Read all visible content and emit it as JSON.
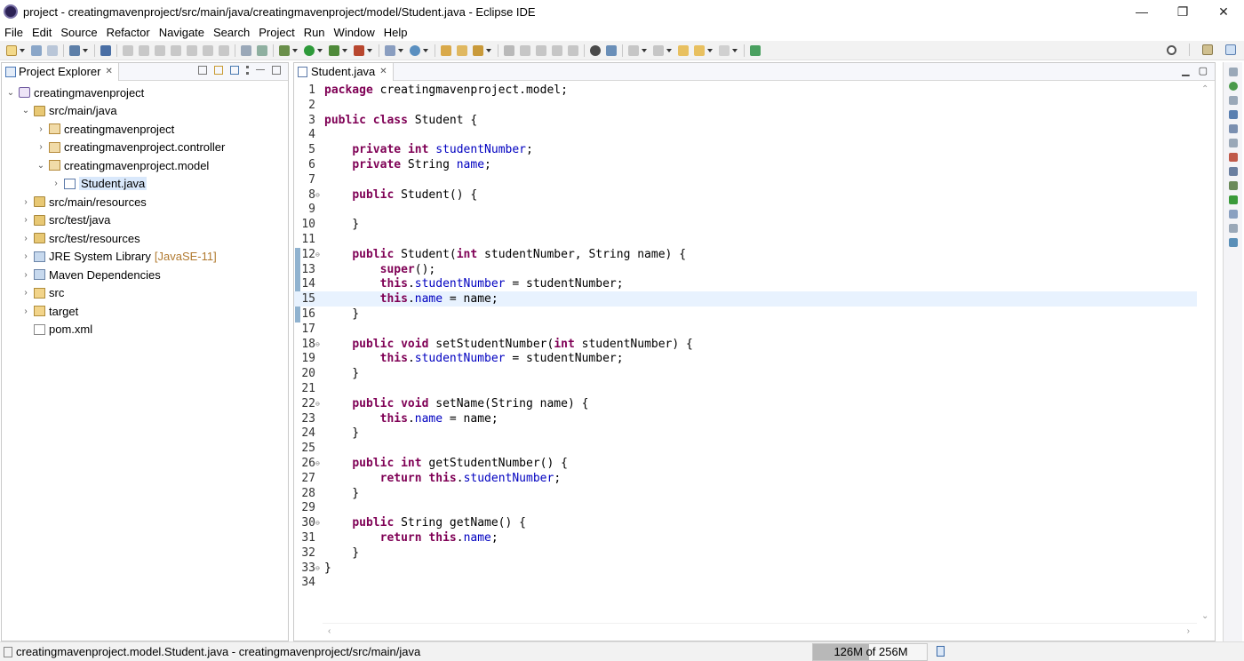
{
  "window": {
    "title": "project - creatingmavenproject/src/main/java/creatingmavenproject/model/Student.java - Eclipse IDE",
    "minimize": "—",
    "restore": "❐",
    "close": "✕"
  },
  "menu": [
    "File",
    "Edit",
    "Source",
    "Refactor",
    "Navigate",
    "Search",
    "Project",
    "Run",
    "Window",
    "Help"
  ],
  "explorer": {
    "tab_label": "Project Explorer",
    "tab_close": "✕",
    "items": [
      {
        "label": "creatingmavenproject",
        "indent": 0,
        "twisty": "⌄",
        "icon": "project-icon"
      },
      {
        "label": "src/main/java",
        "indent": 1,
        "twisty": "⌄",
        "icon": "source-folder-icon"
      },
      {
        "label": "creatingmavenproject",
        "indent": 2,
        "twisty": "›",
        "icon": "package-icon"
      },
      {
        "label": "creatingmavenproject.controller",
        "indent": 2,
        "twisty": "›",
        "icon": "package-icon"
      },
      {
        "label": "creatingmavenproject.model",
        "indent": 2,
        "twisty": "⌄",
        "icon": "package-icon"
      },
      {
        "label": "Student.java",
        "indent": 3,
        "twisty": "›",
        "icon": "java-file-icon",
        "selected": true
      },
      {
        "label": "src/main/resources",
        "indent": 1,
        "twisty": "›",
        "icon": "source-folder-icon"
      },
      {
        "label": "src/test/java",
        "indent": 1,
        "twisty": "›",
        "icon": "source-folder-icon"
      },
      {
        "label": "src/test/resources",
        "indent": 1,
        "twisty": "›",
        "icon": "source-folder-icon"
      },
      {
        "label": "JRE System Library",
        "suffix": "[JavaSE-11]",
        "indent": 1,
        "twisty": "›",
        "icon": "library-icon"
      },
      {
        "label": "Maven Dependencies",
        "indent": 1,
        "twisty": "›",
        "icon": "library-icon"
      },
      {
        "label": "src",
        "indent": 1,
        "twisty": "›",
        "icon": "folder-icon"
      },
      {
        "label": "target",
        "indent": 1,
        "twisty": "›",
        "icon": "folder-icon"
      },
      {
        "label": "pom.xml",
        "indent": 1,
        "twisty": "",
        "icon": "xml-file-icon"
      }
    ]
  },
  "editor": {
    "tab_label": "Student.java",
    "tab_close": "✕",
    "current_line": 15,
    "lines": [
      {
        "n": "1",
        "fold": "",
        "tokens": [
          [
            "kw",
            "package"
          ],
          [
            "t",
            " creatingmavenproject.model;"
          ]
        ]
      },
      {
        "n": "2",
        "fold": "",
        "tokens": []
      },
      {
        "n": "3",
        "fold": "",
        "tokens": [
          [
            "kw",
            "public"
          ],
          [
            "t",
            " "
          ],
          [
            "kw",
            "class"
          ],
          [
            "t",
            " Student {"
          ]
        ]
      },
      {
        "n": "4",
        "fold": "",
        "tokens": []
      },
      {
        "n": "5",
        "fold": "",
        "tokens": [
          [
            "t",
            "    "
          ],
          [
            "kw",
            "private"
          ],
          [
            "t",
            " "
          ],
          [
            "kw",
            "int"
          ],
          [
            "t",
            " "
          ],
          [
            "fld",
            "studentNumber"
          ],
          [
            "t",
            ";"
          ]
        ]
      },
      {
        "n": "6",
        "fold": "",
        "tokens": [
          [
            "t",
            "    "
          ],
          [
            "kw",
            "private"
          ],
          [
            "t",
            " String "
          ],
          [
            "fld",
            "name"
          ],
          [
            "t",
            ";"
          ]
        ]
      },
      {
        "n": "7",
        "fold": "",
        "tokens": []
      },
      {
        "n": "8",
        "fold": "⊖",
        "tokens": [
          [
            "t",
            "    "
          ],
          [
            "kw",
            "public"
          ],
          [
            "t",
            " Student() {"
          ]
        ]
      },
      {
        "n": "9",
        "fold": "",
        "tokens": []
      },
      {
        "n": "10",
        "fold": "",
        "tokens": [
          [
            "t",
            "    }"
          ]
        ]
      },
      {
        "n": "11",
        "fold": "",
        "tokens": []
      },
      {
        "n": "12",
        "fold": "⊖",
        "tokens": [
          [
            "t",
            "    "
          ],
          [
            "kw",
            "public"
          ],
          [
            "t",
            " Student("
          ],
          [
            "kw",
            "int"
          ],
          [
            "t",
            " studentNumber, String name) {"
          ]
        ]
      },
      {
        "n": "13",
        "fold": "",
        "tokens": [
          [
            "t",
            "        "
          ],
          [
            "kw",
            "super"
          ],
          [
            "t",
            "();"
          ]
        ]
      },
      {
        "n": "14",
        "fold": "",
        "tokens": [
          [
            "t",
            "        "
          ],
          [
            "kw",
            "this"
          ],
          [
            "t",
            "."
          ],
          [
            "fld",
            "studentNumber"
          ],
          [
            "t",
            " = studentNumber;"
          ]
        ]
      },
      {
        "n": "15",
        "fold": "",
        "tokens": [
          [
            "t",
            "        "
          ],
          [
            "kw",
            "this"
          ],
          [
            "t",
            "."
          ],
          [
            "fld",
            "name"
          ],
          [
            "t",
            " = name;"
          ]
        ]
      },
      {
        "n": "16",
        "fold": "",
        "tokens": [
          [
            "t",
            "    }"
          ]
        ]
      },
      {
        "n": "17",
        "fold": "",
        "tokens": []
      },
      {
        "n": "18",
        "fold": "⊖",
        "tokens": [
          [
            "t",
            "    "
          ],
          [
            "kw",
            "public"
          ],
          [
            "t",
            " "
          ],
          [
            "kw",
            "void"
          ],
          [
            "t",
            " setStudentNumber("
          ],
          [
            "kw",
            "int"
          ],
          [
            "t",
            " studentNumber) {"
          ]
        ]
      },
      {
        "n": "19",
        "fold": "",
        "tokens": [
          [
            "t",
            "        "
          ],
          [
            "kw",
            "this"
          ],
          [
            "t",
            "."
          ],
          [
            "fld",
            "studentNumber"
          ],
          [
            "t",
            " = studentNumber;"
          ]
        ]
      },
      {
        "n": "20",
        "fold": "",
        "tokens": [
          [
            "t",
            "    }"
          ]
        ]
      },
      {
        "n": "21",
        "fold": "",
        "tokens": []
      },
      {
        "n": "22",
        "fold": "⊖",
        "tokens": [
          [
            "t",
            "    "
          ],
          [
            "kw",
            "public"
          ],
          [
            "t",
            " "
          ],
          [
            "kw",
            "void"
          ],
          [
            "t",
            " setName(String name) {"
          ]
        ]
      },
      {
        "n": "23",
        "fold": "",
        "tokens": [
          [
            "t",
            "        "
          ],
          [
            "kw",
            "this"
          ],
          [
            "t",
            "."
          ],
          [
            "fld",
            "name"
          ],
          [
            "t",
            " = name;"
          ]
        ]
      },
      {
        "n": "24",
        "fold": "",
        "tokens": [
          [
            "t",
            "    }"
          ]
        ]
      },
      {
        "n": "25",
        "fold": "",
        "tokens": []
      },
      {
        "n": "26",
        "fold": "⊖",
        "tokens": [
          [
            "t",
            "    "
          ],
          [
            "kw",
            "public"
          ],
          [
            "t",
            " "
          ],
          [
            "kw",
            "int"
          ],
          [
            "t",
            " getStudentNumber() {"
          ]
        ]
      },
      {
        "n": "27",
        "fold": "",
        "tokens": [
          [
            "t",
            "        "
          ],
          [
            "kw",
            "return"
          ],
          [
            "t",
            " "
          ],
          [
            "kw",
            "this"
          ],
          [
            "t",
            "."
          ],
          [
            "fld",
            "studentNumber"
          ],
          [
            "t",
            ";"
          ]
        ]
      },
      {
        "n": "28",
        "fold": "",
        "tokens": [
          [
            "t",
            "    }"
          ]
        ]
      },
      {
        "n": "29",
        "fold": "",
        "tokens": []
      },
      {
        "n": "30",
        "fold": "⊖",
        "tokens": [
          [
            "t",
            "    "
          ],
          [
            "kw",
            "public"
          ],
          [
            "t",
            " String getName() {"
          ]
        ]
      },
      {
        "n": "31",
        "fold": "",
        "tokens": [
          [
            "t",
            "        "
          ],
          [
            "kw",
            "return"
          ],
          [
            "t",
            " "
          ],
          [
            "kw",
            "this"
          ],
          [
            "t",
            "."
          ],
          [
            "fld",
            "name"
          ],
          [
            "t",
            ";"
          ]
        ]
      },
      {
        "n": "32",
        "fold": "",
        "tokens": [
          [
            "t",
            "    }"
          ]
        ]
      },
      {
        "n": "33",
        "fold": "⊖",
        "tokens": [
          [
            "t",
            "}"
          ]
        ]
      },
      {
        "n": "34",
        "fold": "",
        "tokens": []
      }
    ]
  },
  "status": {
    "text": "creatingmavenproject.model.Student.java - creatingmavenproject/src/main/java",
    "heap_label": "126M of 256M",
    "heap_used_fraction": 0.49
  },
  "colors": {
    "keyword": "#7f0055",
    "field": "#0000c0",
    "current_line": "#e8f2fe",
    "selection": "#d9e8fb"
  }
}
